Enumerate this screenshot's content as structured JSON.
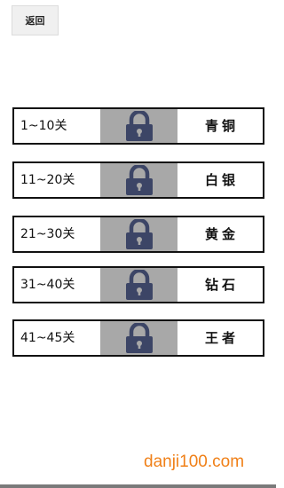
{
  "header": {
    "back_label": "返回"
  },
  "levels": [
    {
      "range": "1~10关",
      "tier": "青铜",
      "locked": true,
      "icon": "lock-icon"
    },
    {
      "range": "11~20关",
      "tier": "白银",
      "locked": true,
      "icon": "lock-icon"
    },
    {
      "range": "21~30关",
      "tier": "黄金",
      "locked": true,
      "icon": "lock-icon"
    },
    {
      "range": "31~40关",
      "tier": "钻石",
      "locked": true,
      "icon": "lock-icon"
    },
    {
      "range": "41~45关",
      "tier": "王者",
      "locked": true,
      "icon": "lock-icon"
    }
  ],
  "watermark": {
    "text": "danji100.com"
  },
  "colors": {
    "lock": "#3c4566",
    "lock_bg": "#a8a8a8",
    "watermark": "#f08018"
  }
}
